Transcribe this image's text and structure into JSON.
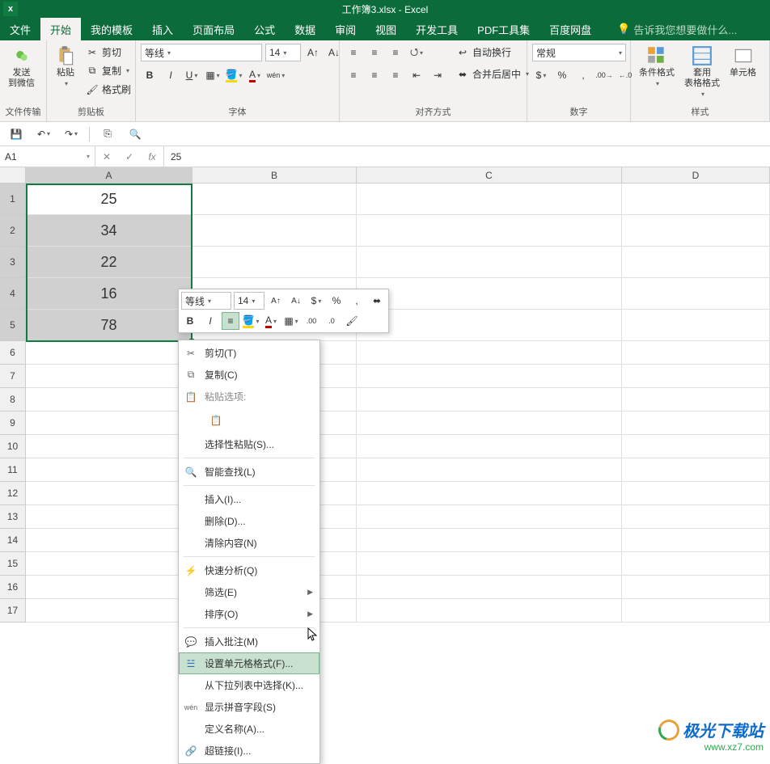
{
  "title": "工作簿3.xlsx - Excel",
  "tabs": {
    "file": "文件",
    "home": "开始",
    "templates": "我的模板",
    "insert": "插入",
    "page_layout": "页面布局",
    "formulas": "公式",
    "data": "数据",
    "review": "审阅",
    "view": "视图",
    "developer": "开发工具",
    "pdf": "PDF工具集",
    "baidu": "百度网盘",
    "tell_me": "告诉我您想要做什么..."
  },
  "ribbon": {
    "wechat": {
      "send": "发送\n到微信",
      "group": "文件传输"
    },
    "clipboard": {
      "paste": "粘贴",
      "cut": "剪切",
      "copy": "复制",
      "format_painter": "格式刷",
      "group": "剪贴板"
    },
    "font": {
      "name": "等线",
      "size": "14",
      "bold": "B",
      "italic": "I",
      "underline": "U",
      "pinyin": "wén",
      "group": "字体"
    },
    "align": {
      "wrap": "自动换行",
      "merge": "合并后居中",
      "group": "对齐方式"
    },
    "number": {
      "format": "常规",
      "group": "数字"
    },
    "styles": {
      "conditional": "条件格式",
      "table": "套用\n表格格式",
      "cell": "单元格",
      "group": "样式"
    }
  },
  "name_box": "A1",
  "formula_value": "25",
  "columns": [
    "A",
    "B",
    "C",
    "D"
  ],
  "rows": [
    1,
    2,
    3,
    4,
    5,
    6,
    7,
    8,
    9,
    10,
    11,
    12,
    13,
    14,
    15,
    16,
    17
  ],
  "cells": {
    "a1": "25",
    "a2": "34",
    "a3": "22",
    "a4": "16",
    "a5": "78"
  },
  "mini": {
    "font": "等线",
    "size": "14",
    "percent": "%",
    "comma": ","
  },
  "menu": {
    "cut": "剪切(T)",
    "copy": "复制(C)",
    "paste_options": "粘贴选项:",
    "paste_special": "选择性粘贴(S)...",
    "smart_lookup": "智能查找(L)",
    "insert": "插入(I)...",
    "delete": "删除(D)...",
    "clear": "清除内容(N)",
    "quick_analysis": "快速分析(Q)",
    "filter": "筛选(E)",
    "sort": "排序(O)",
    "insert_comment": "插入批注(M)",
    "format_cells": "设置单元格格式(F)...",
    "pick_from_list": "从下拉列表中选择(K)...",
    "show_phonetic": "显示拼音字段(S)",
    "define_name": "定义名称(A)...",
    "hyperlink": "超链接(I)..."
  },
  "watermark": {
    "title": "极光下载站",
    "url": "www.xz7.com"
  }
}
